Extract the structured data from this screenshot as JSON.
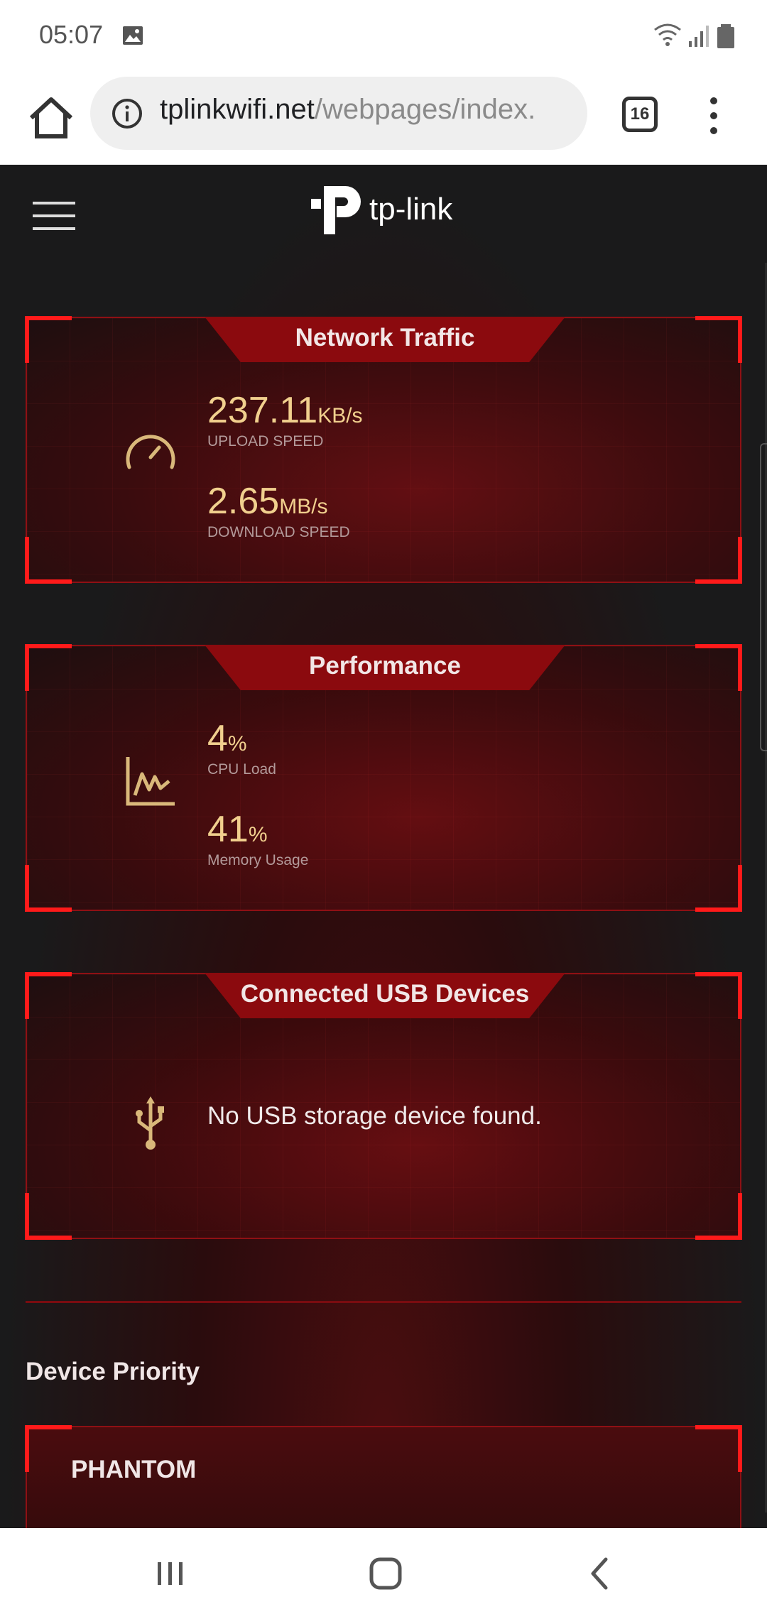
{
  "status_bar": {
    "time": "05:07"
  },
  "browser": {
    "url_host": "tplinkwifi.net",
    "url_path": "/webpages/index.",
    "tab_count": "16"
  },
  "header": {
    "logo_text": "tp-link"
  },
  "cards": [
    {
      "title": "Network Traffic",
      "icon": "speedometer-icon",
      "metrics": [
        {
          "value": "237.11",
          "unit": "KB/s",
          "label": "UPLOAD SPEED"
        },
        {
          "value": "2.65",
          "unit": "MB/s",
          "label": "DOWNLOAD SPEED"
        }
      ]
    },
    {
      "title": "Performance",
      "icon": "line-chart-icon",
      "metrics": [
        {
          "value": "4",
          "unit": "%",
          "label": "CPU Load"
        },
        {
          "value": "41",
          "unit": "%",
          "label": "Memory Usage"
        }
      ]
    },
    {
      "title": "Connected USB Devices",
      "icon": "usb-icon",
      "message": "No USB storage device found."
    }
  ],
  "device_priority": {
    "title": "Device Priority",
    "device_name": "PHANTOM"
  },
  "colors": {
    "accent_red": "#ff1a1a",
    "tab_red": "#8b0a0e",
    "metric_gold": "#f1d08e"
  }
}
